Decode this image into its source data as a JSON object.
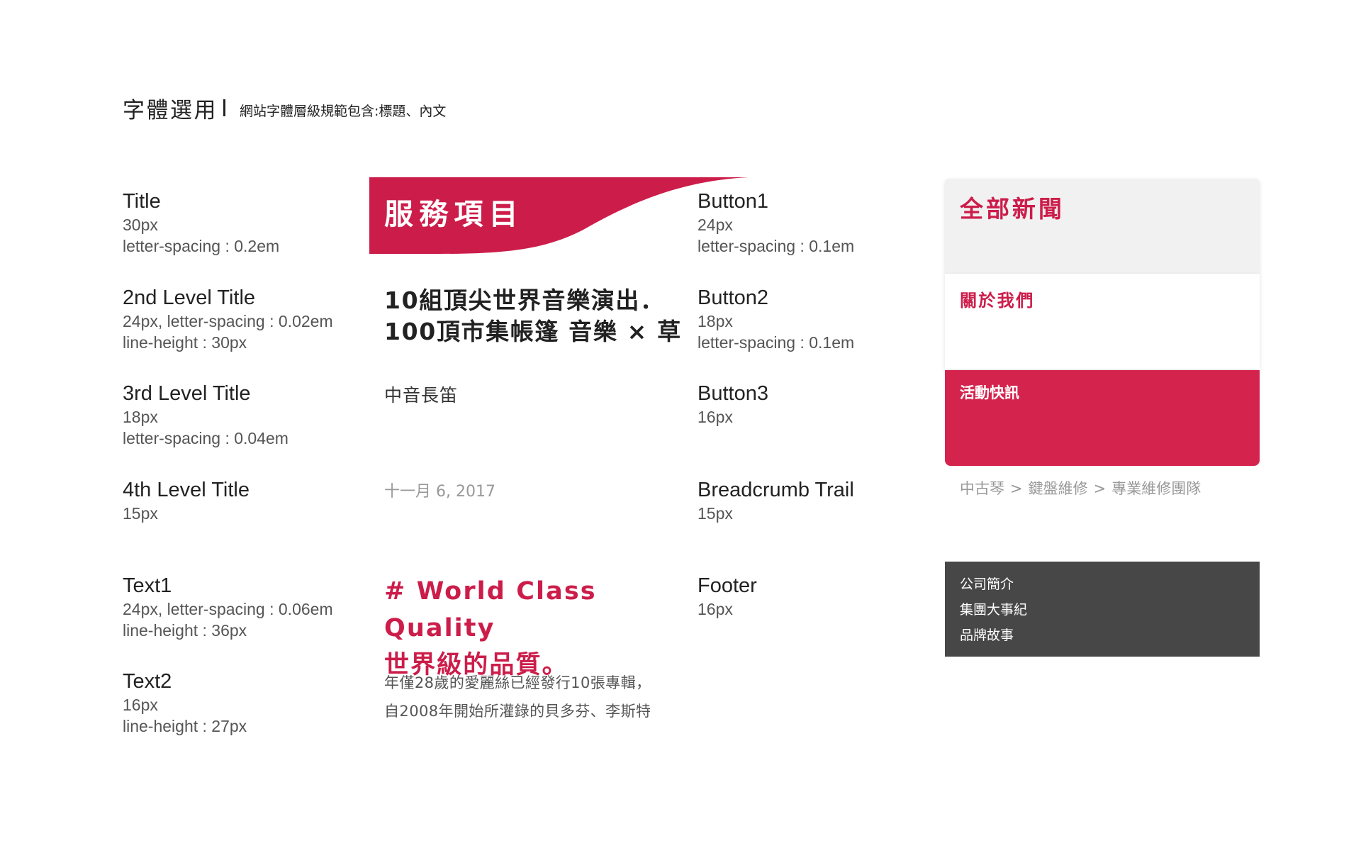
{
  "header": {
    "title": "字體選用",
    "subtitle": "網站字體層級規範包含:標題、內文"
  },
  "specs_left": [
    {
      "name": "Title",
      "details": [
        "30px",
        "letter-spacing : 0.2em"
      ]
    },
    {
      "name": "2nd Level Title",
      "details": [
        "24px, letter-spacing : 0.02em",
        "line-height : 30px"
      ]
    },
    {
      "name": "3rd Level Title",
      "details": [
        "18px",
        "letter-spacing : 0.04em"
      ]
    },
    {
      "name": "4th Level Title",
      "details": [
        "15px"
      ]
    },
    {
      "name": "Text1",
      "details": [
        "24px, letter-spacing : 0.06em",
        "line-height : 36px"
      ]
    },
    {
      "name": "Text2",
      "details": [
        "16px",
        "line-height : 27px"
      ]
    }
  ],
  "samples": {
    "title": "服務項目",
    "second_level": [
      "10組頂尖世界音樂演出．",
      "100頂市集帳篷 音樂 × 草"
    ],
    "third_level": "中音長笛",
    "fourth_level": "十一月 6, 2017",
    "text1": [
      "# World Class Quality",
      "世界級的品質。"
    ],
    "text2": [
      "年僅28歲的愛麗絲已經發行10張專輯，",
      "自2008年開始所灌錄的貝多芬、李斯特"
    ]
  },
  "specs_right": [
    {
      "name": "Button1",
      "details": [
        "24px",
        "letter-spacing : 0.1em"
      ]
    },
    {
      "name": "Button2",
      "details": [
        "18px",
        "letter-spacing : 0.1em"
      ]
    },
    {
      "name": "Button3",
      "details": [
        "16px"
      ]
    },
    {
      "name": "Breadcrumb Trail",
      "details": [
        "15px"
      ]
    },
    {
      "name": "Footer",
      "details": [
        "16px"
      ]
    }
  ],
  "buttons": {
    "button1": "全部新聞",
    "button2": "關於我們",
    "button3": "活動快訊"
  },
  "breadcrumb": {
    "items": [
      "中古琴",
      "鍵盤維修",
      "專業維修團隊"
    ],
    "separator": ">"
  },
  "footer": {
    "items": [
      "公司簡介",
      "集團大事紀",
      "品牌故事"
    ]
  },
  "colors": {
    "accent": "#cc1d4a",
    "button3_bg": "#d4244e",
    "footer_bg": "#474747"
  }
}
